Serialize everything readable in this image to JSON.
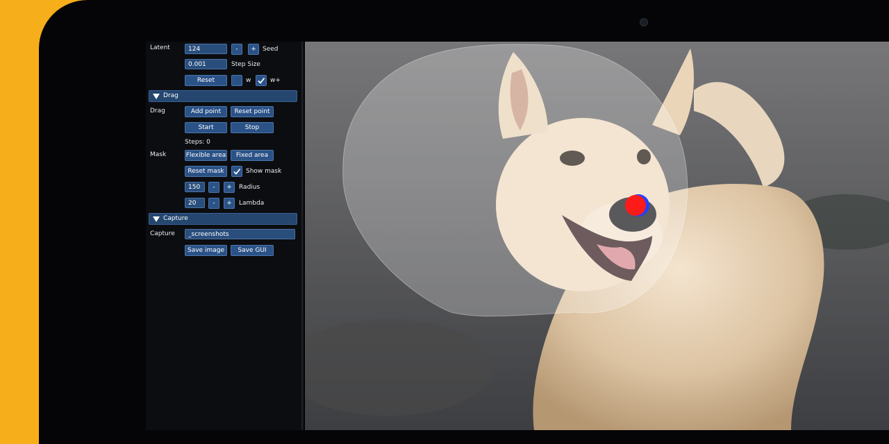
{
  "panel": {
    "latent": {
      "label": "Latent",
      "seed_value": "124",
      "seed_label": "Seed",
      "step_value": "0.001",
      "step_label": "Step Size",
      "reset_label": "Reset",
      "w_label": "w",
      "wplus_label": "w+",
      "minus": "-",
      "plus": "+"
    },
    "drag": {
      "section_title": "Drag",
      "label": "Drag",
      "add_point": "Add point",
      "reset_point": "Reset point",
      "start": "Start",
      "stop": "Stop",
      "steps": "Steps: 0"
    },
    "mask": {
      "label": "Mask",
      "flexible": "Flexible area",
      "fixed": "Fixed area",
      "reset_mask": "Reset mask",
      "show_mask": "Show mask",
      "radius_value": "150",
      "radius_label": "Radius",
      "lambda_value": "20",
      "lambda_label": "Lambda",
      "minus": "-",
      "plus": "+"
    },
    "capture": {
      "section_title": "Capture",
      "label": "Capture",
      "path_value": "_screenshots",
      "save_image": "Save image",
      "save_gui": "Save GUI"
    }
  },
  "viewport": {
    "image_subject": "dog-photo",
    "mask_circle_color": "#ffffff",
    "handle_point_color": "#ff1a1a",
    "target_point_color": "#2040ff"
  },
  "colors": {
    "accent_button": "#2b5287",
    "panel_bg": "#0c0d10",
    "frame_yellow": "#f6ae1a"
  }
}
